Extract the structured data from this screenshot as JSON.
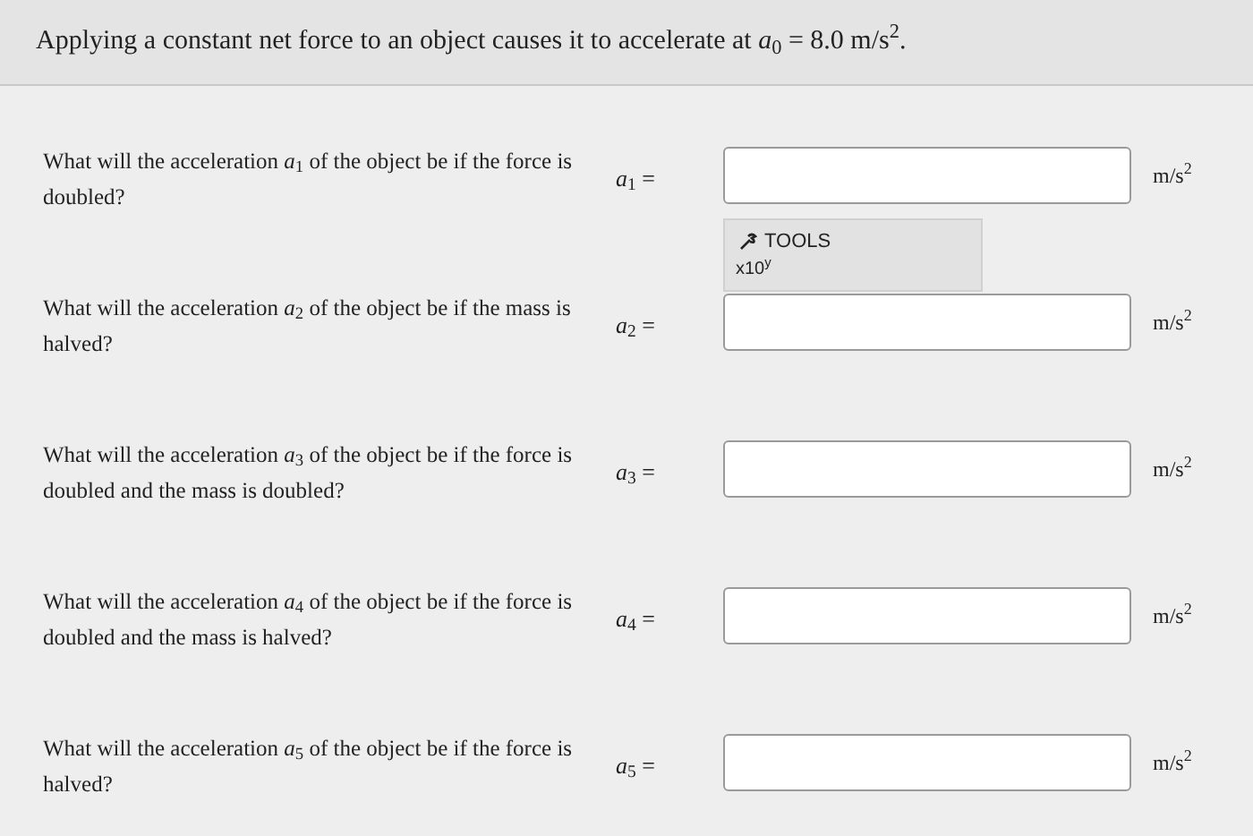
{
  "prompt": "Applying a constant net force to an object causes it to accelerate at *a*$_{0}$ = 8.0 m/s$^{2}$.",
  "questions": [
    {
      "question": "What will the acceleration *a*$_{1}$ of the object be if the force is doubled?",
      "label": "*a*$_{1}$ =",
      "unit": "m/s$^{2}$",
      "tools": {
        "title": "TOOLS",
        "button": "x10$^{y}$"
      }
    },
    {
      "question": "What will the acceleration *a*$_{2}$ of the object be if the mass is halved?",
      "label": "*a*$_{2}$ =",
      "unit": "m/s$^{2}$"
    },
    {
      "question": "What will the acceleration *a*$_{3}$ of the object be if the force is doubled and the mass is doubled?",
      "label": "*a*$_{3}$ =",
      "unit": "m/s$^{2}$"
    },
    {
      "question": "What will the acceleration *a*$_{4}$ of the object be if the force is doubled and the mass is halved?",
      "label": "*a*$_{4}$ =",
      "unit": "m/s$^{2}$"
    },
    {
      "question": "What will the acceleration *a*$_{5}$ of the object be if the force is halved?",
      "label": "*a*$_{5}$ =",
      "unit": "m/s$^{2}$"
    }
  ]
}
